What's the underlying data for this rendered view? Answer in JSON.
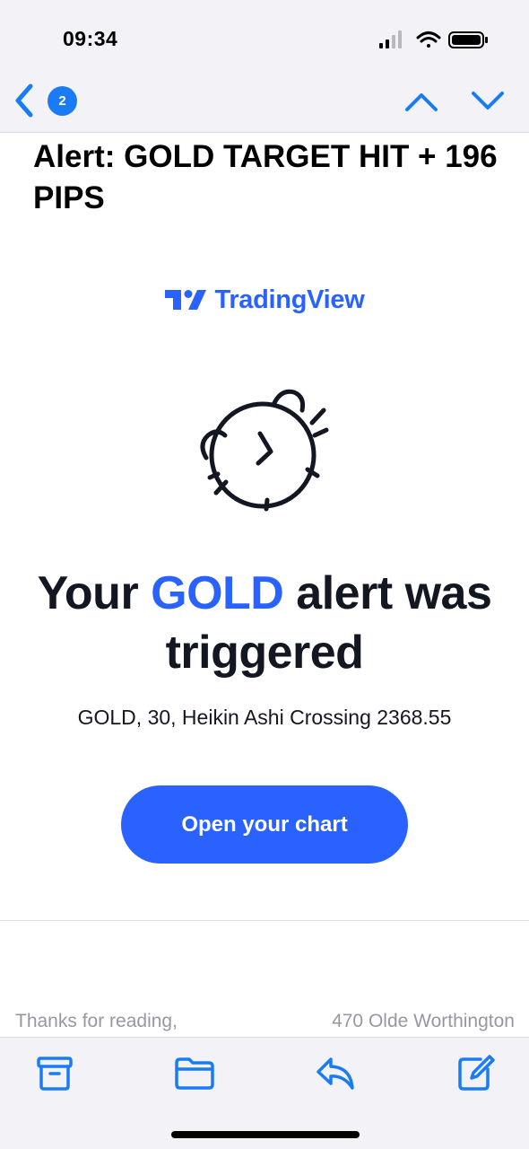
{
  "status_bar": {
    "time": "09:34",
    "icons": [
      "cellular-signal-icon",
      "wifi-icon",
      "battery-icon"
    ]
  },
  "nav": {
    "back_icon": "chevron-left-icon",
    "unread_count": "2",
    "prev_icon": "chevron-up-icon",
    "next_icon": "chevron-down-icon"
  },
  "email": {
    "subject": "Alert: GOLD TARGET HIT + 196 PIPS",
    "brand_name": "TradingView",
    "headline_before": "Your ",
    "headline_accent": "GOLD",
    "headline_after": " alert was triggered",
    "detail": "GOLD, 30, Heikin Ashi Crossing 2368.55",
    "cta_label": "Open your chart",
    "footer_left": "Thanks for reading,",
    "footer_right": "470 Olde Worthington"
  },
  "toolbar": {
    "items": [
      "archive-icon",
      "folder-icon",
      "reply-icon",
      "compose-icon"
    ]
  },
  "colors": {
    "ios_blue": "#1a7cf5",
    "brand_blue": "#2962ff",
    "text_dark": "#131722",
    "footer_gray": "#9598a1",
    "bar_bg": "#f2f2f7"
  }
}
